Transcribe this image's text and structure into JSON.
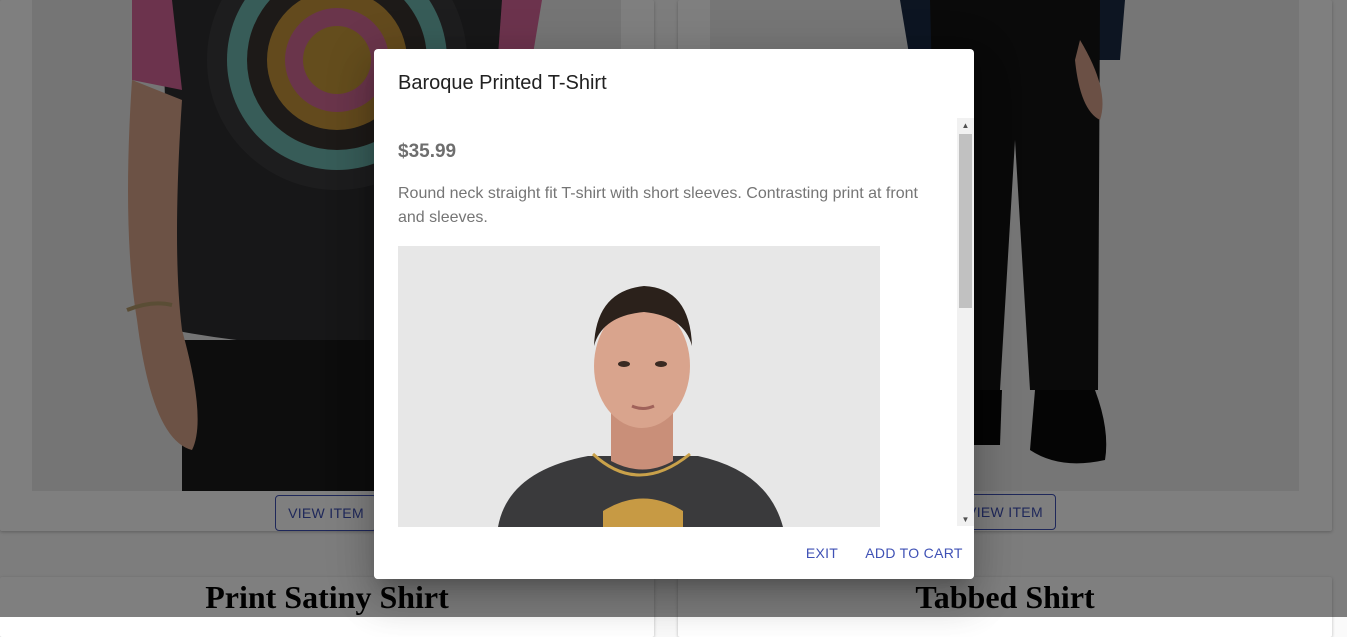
{
  "background": {
    "cards": [
      {
        "view_label": "VIEW ITEM"
      },
      {
        "view_label": "VIEW ITEM"
      }
    ],
    "titles": [
      "Print Satiny Shirt",
      "Tabbed Shirt"
    ]
  },
  "dialog": {
    "title": "Baroque Printed T-Shirt",
    "price": "$35.99",
    "description": "Round neck straight fit T-shirt with short sleeves. Contrasting print at front and sleeves.",
    "actions": {
      "exit": "EXIT",
      "add_to_cart": "ADD TO CART"
    }
  },
  "colors": {
    "accent": "#3f51b5",
    "scrim": "rgba(0,0,0,0.5)"
  },
  "icons": [
    "scroll-up-arrow-icon",
    "scroll-down-arrow-icon"
  ]
}
